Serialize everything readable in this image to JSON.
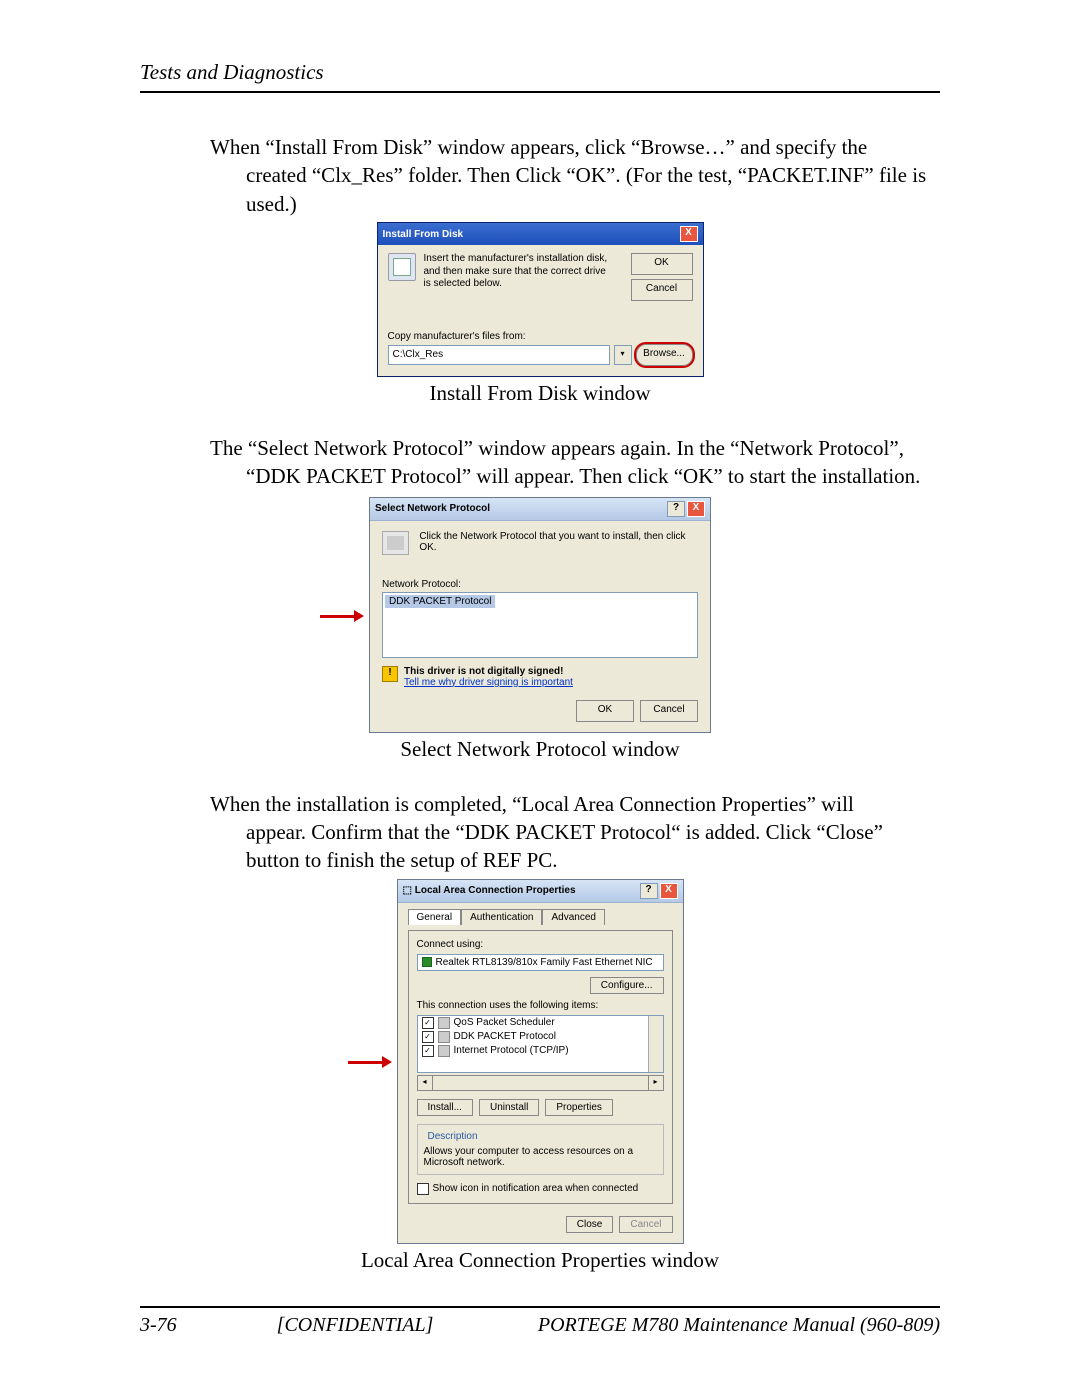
{
  "header": {
    "title": "Tests and Diagnostics"
  },
  "para1": {
    "line1": "When “Install From Disk” window appears, click “Browse…” and specify the",
    "line2": "created “Clx_Res” folder. Then Click “OK”. (For the test, “PACKET.INF” file is used.)"
  },
  "ifd": {
    "title": "Install From Disk",
    "msg": "Insert the manufacturer's installation disk, and then make sure that the correct drive is selected below.",
    "ok": "OK",
    "cancel": "Cancel",
    "copy_label": "Copy manufacturer's files from:",
    "path": "C:\\Clx_Res",
    "browse": "Browse..."
  },
  "caption1": "Install From Disk window",
  "para2": {
    "line1": "The “Select Network Protocol” window appears again. In the “Network Protocol”,",
    "line2": "“DDK PACKET Protocol” will appear. Then click “OK” to start the installation."
  },
  "snp": {
    "title": "Select Network Protocol",
    "msg": "Click the Network Protocol that you want to install, then click OK.",
    "list_label": "Network Protocol:",
    "item": "DDK PACKET Protocol",
    "warn_bold": "This driver is not digitally signed!",
    "warn_link": "Tell me why driver signing is important",
    "ok": "OK",
    "cancel": "Cancel"
  },
  "caption2": "Select Network Protocol window",
  "para3": {
    "line1": "When the installation is completed, “Local Area Connection Properties” will",
    "line2": "appear. Confirm that the “DDK PACKET Protocol“ is added. Click “Close” button to finish the setup of REF PC."
  },
  "lacp": {
    "title": "Local Area Connection Properties",
    "tab_general": "General",
    "tab_auth": "Authentication",
    "tab_adv": "Advanced",
    "connect_label": "Connect using:",
    "nic": "Realtek RTL8139/810x Family Fast Ethernet NIC",
    "configure": "Configure...",
    "items_label": "This connection uses the following items:",
    "item1": "QoS Packet Scheduler",
    "item2": "DDK PACKET Protocol",
    "item3": "Internet Protocol (TCP/IP)",
    "install": "Install...",
    "uninstall": "Uninstall",
    "properties": "Properties",
    "desc_title": "Description",
    "desc_text": "Allows your computer to access resources on a Microsoft network.",
    "show_icon": "Show icon in notification area when connected",
    "close": "Close",
    "cancel": "Cancel"
  },
  "caption3": "Local Area Connection Properties window",
  "footer": {
    "page": "3-76",
    "conf": "[CONFIDENTIAL]",
    "manual": "PORTEGE M780 Maintenance Manual (960-809)"
  }
}
